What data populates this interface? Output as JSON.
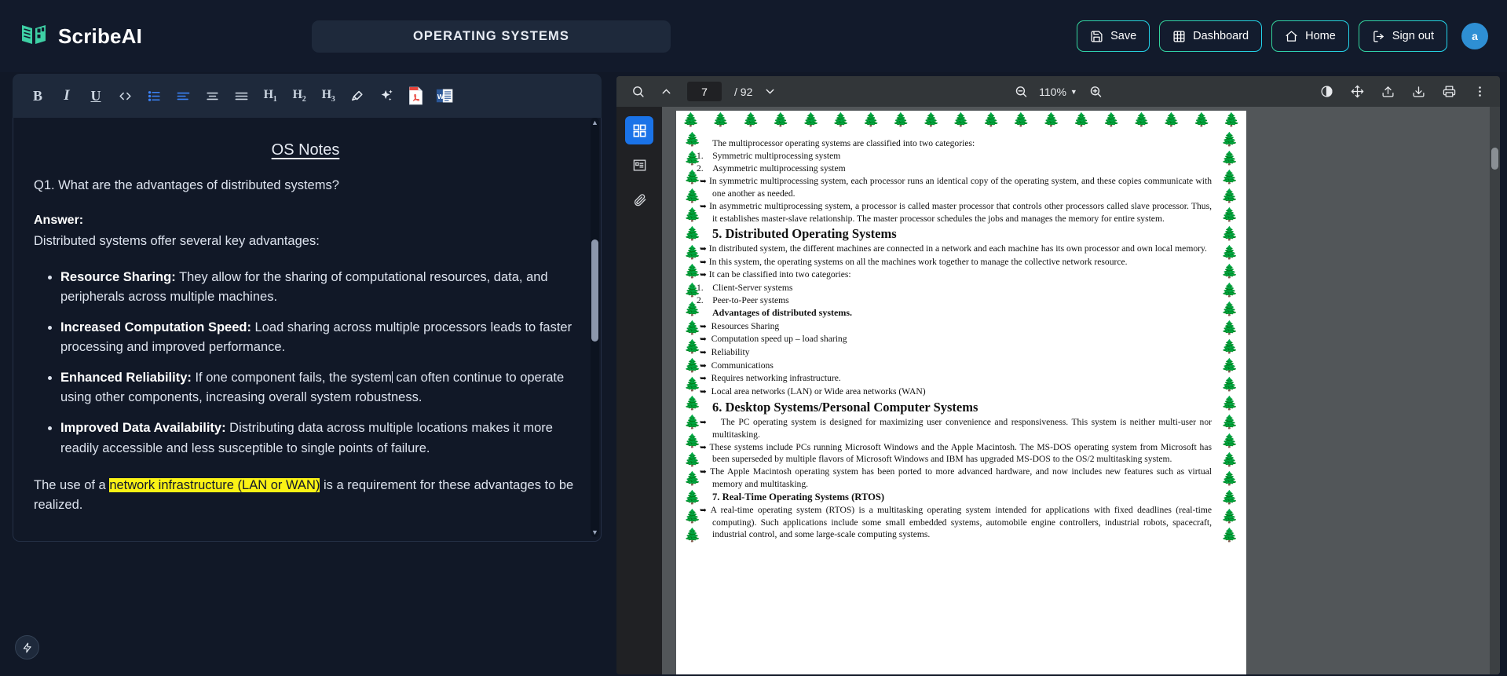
{
  "header": {
    "brand": "ScribeAI",
    "brand_icon": "book-logo-icon",
    "document_title": "OPERATING SYSTEMS",
    "buttons": [
      {
        "label": "Save",
        "icon": "save-icon"
      },
      {
        "label": "Dashboard",
        "icon": "grid-icon"
      },
      {
        "label": "Home",
        "icon": "home-icon"
      },
      {
        "label": "Sign out",
        "icon": "sign-out-icon"
      }
    ],
    "avatar_initial": "a",
    "accent_from": "#34D399",
    "accent_to": "#22D3EE"
  },
  "toolbar": {
    "items": [
      {
        "name": "bold",
        "glyph": "B"
      },
      {
        "name": "italic",
        "glyph": "I"
      },
      {
        "name": "underline",
        "glyph": "U"
      },
      {
        "name": "code-block",
        "glyph": "<>"
      },
      {
        "name": "bullet-list",
        "glyph": ""
      },
      {
        "name": "align-left",
        "glyph": ""
      },
      {
        "name": "align-center",
        "glyph": ""
      },
      {
        "name": "align-justify",
        "glyph": ""
      },
      {
        "name": "heading-1",
        "glyph": "H1"
      },
      {
        "name": "heading-2",
        "glyph": "H2"
      },
      {
        "name": "heading-3",
        "glyph": "H3"
      },
      {
        "name": "highlighter",
        "glyph": ""
      },
      {
        "name": "ai-sparkle",
        "glyph": ""
      },
      {
        "name": "export-pdf",
        "glyph": "PDF"
      },
      {
        "name": "export-word",
        "glyph": "W"
      }
    ]
  },
  "editor": {
    "title": "OS Notes",
    "question": "Q1. What are the advantages of distributed systems?",
    "answer_label": "Answer:",
    "answer_intro": "Distributed systems offer several key advantages:",
    "bullets": [
      {
        "term": "Resource Sharing:",
        "text": " They allow for the sharing of computational resources, data, and peripherals across multiple machines."
      },
      {
        "term": "Increased Computation Speed:",
        "text": " Load sharing across multiple processors leads to faster processing and improved performance."
      },
      {
        "term": "Enhanced Reliability:",
        "text_before": " If one component fails, the system",
        "text_after": " can often continue to operate using other components, increasing overall system robustness."
      },
      {
        "term": "Improved Data Availability:",
        "text": " Distributing data across multiple locations makes it more readily accessible and less susceptible to single points of failure."
      }
    ],
    "closing_before": "The use of a ",
    "closing_highlight": "network infrastructure (LAN or WAN)",
    "closing_after": " is a requirement for these advantages to be realized.",
    "highlight_color": "#FAF215",
    "fab_icon": "lightning-icon"
  },
  "pdf": {
    "current_page": "7",
    "total_pages": "/ 92",
    "zoom_level": "110%",
    "search_icon": "search-icon",
    "prev_icon": "chevron-up-icon",
    "next_icon": "chevron-down-icon",
    "zoom_out_icon": "zoom-out-icon",
    "zoom_in_icon": "zoom-in-icon",
    "right_tools": [
      "contrast-icon",
      "pan-icon",
      "upload-icon",
      "download-icon",
      "print-icon",
      "more-options-icon"
    ],
    "sidebar_tools": [
      {
        "name": "thumbnails-icon",
        "active": true
      },
      {
        "name": "outline-icon",
        "active": false
      },
      {
        "name": "attachments-icon",
        "active": false
      }
    ],
    "page_content": {
      "intro": "The multiprocessor operating systems are classified into two categories:",
      "numbered": [
        "Symmetric multiprocessing system",
        "Asymmetric multiprocessing system"
      ],
      "bullets_top": [
        "In symmetric multiprocessing system, each processor runs an identical copy of the operating system, and these copies communicate with one another as needed.",
        "In asymmetric multiprocessing system, a processor is called master processor that controls other processors called slave processor. Thus, it establishes master-slave relationship. The master processor schedules the jobs and manages the memory for entire system."
      ],
      "section5_heading": "5. Distributed Operating Systems",
      "section5_bullets": [
        "In distributed system, the different machines are connected in a network and each machine has its own processor and own local memory.",
        "In this system, the operating systems on all the machines work together to manage the collective network resource.",
        "It can be classified into two categories:"
      ],
      "section5_numbered": [
        "Client-Server systems",
        "Peer-to-Peer systems"
      ],
      "adv_heading": "Advantages of distributed systems.",
      "adv_bullets": [
        "Resources Sharing",
        "Computation speed up – load sharing",
        "Reliability",
        "Communications",
        "Requires networking infrastructure.",
        "Local area networks (LAN) or Wide area networks (WAN)"
      ],
      "section6_heading": "6. Desktop Systems/Personal Computer Systems",
      "section6_bullets": [
        "The PC operating system is designed for maximizing user convenience and responsiveness. This system is neither multi-user nor multitasking.",
        "These systems include PCs running Microsoft Windows and the Apple Macintosh. The MS-DOS operating system from Microsoft has been superseded by multiple flavors of Microsoft Windows and IBM has upgraded MS-DOS to the OS/2 multitasking system.",
        "The Apple Macintosh operating system has been ported to more advanced hardware, and now includes new features such as virtual memory and multitasking."
      ],
      "section7_heading": "7. Real-Time Operating Systems (RTOS)",
      "section7_bullets": [
        "A real-time operating system (RTOS) is a multitasking operating system intended for applications with fixed deadlines (real-time computing). Such applications include some small embedded systems, automobile engine controllers, industrial robots, spacecraft, industrial control, and some large-scale computing systems."
      ]
    }
  }
}
